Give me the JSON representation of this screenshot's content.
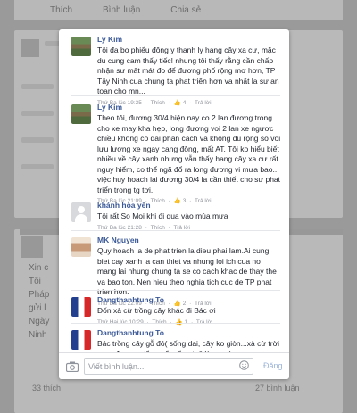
{
  "background": {
    "top_actions": [
      "Thích",
      "Bình luận",
      "Chia sẻ"
    ],
    "snippets": [
      "Xin c",
      "Tôi ",
      "Pháp",
      "gửi l",
      "Ngày",
      "Ninh"
    ],
    "footer_count": "33 thích",
    "footer_comments": "27 bình luận"
  },
  "comments": [
    {
      "author": "Ly Kim",
      "text": "Tôi đa bo phiếu đông y thanh ly hang cây xa cư, mặc du cung cam thấy tiếc! nhung tôi thấy rằng cần chấp nhận sư mất mát đo để đương phố rộng mơ hơn, TP Tây Ninh cua chung ta phat triển hơn va nhất la sư an toan cho mn...",
      "time": "Thứ Ba lúc 19:35",
      "like_label": "Thích",
      "likes": "4",
      "reply_label": "Trả lời"
    },
    {
      "author": "Ly Kim",
      "text": "Theo tôi, đương 30/4 hiện nay co 2 lan đương trong cho xe may kha hẹp, long đương voi 2 lan xe ngươc chiều không co dai phân cach va  không đu rộng so voi lưu lương xe ngay cang đông, mất AT. Tôi ko hiểu biết nhiều về cây xanh nhưng vẫn thấy hang cây xa cư rất nguy hiểm, co thể ngã đổ ra long đương vi mưa bao.. việc huy hoach lai đương 30/4 la cần thiết cho sư phat triển trong tg tơi.",
      "time": "Thứ Ba lúc 21:09",
      "like_label": "Thích",
      "likes": "3",
      "reply_label": "Trả lời"
    },
    {
      "author": "khánh hòa yến",
      "text": "Tôi rất So Moi khi đi qua vào mùa mưa",
      "time": "Thứ Ba lúc 21:28",
      "like_label": "Thích",
      "likes": "",
      "reply_label": "Trả lời"
    },
    {
      "author": "MK Nguyen",
      "text": "Quy hoach la de phat trien la dieu phai lam.Ai cung biet cay xanh la can thiet va nhung loi ich cua no mang lai nhung chung ta se co cach khac de thay the va bao ton. Nen hieu theo nghia tich cuc de TP phat trien hon.",
      "time": "Thứ Ba lúc 22:09",
      "like_label": "Thích",
      "likes": "2",
      "reply_label": "Trả lời"
    },
    {
      "author": "Dangthanhtung To",
      "text": "Đốn xà cừ trồng cây khác đi Bác ơi",
      "time": "Thứ Hai lúc 10:29",
      "like_label": "Thích",
      "likes": "1",
      "reply_label": "Trả lời"
    },
    {
      "author": "Dangthanhtung To",
      "text": "Bác trồng cây gỗ đó( sống dai, cây ko giòn...xà cừ trời mưa đi xe sợ lắm...rắc rắc...thế là xong)",
      "time": "",
      "like_label": "",
      "likes": "",
      "reply_label": ""
    }
  ],
  "compose": {
    "placeholder": "Viết bình luận...",
    "post_label": "Đăng"
  },
  "colors": {
    "name": "#3b5998",
    "meta": "#90949c",
    "post_disabled": "#9cb4d8"
  },
  "icons": {
    "like": "thumbs-up-icon",
    "camera": "camera-icon",
    "emoji": "smiley-icon"
  }
}
